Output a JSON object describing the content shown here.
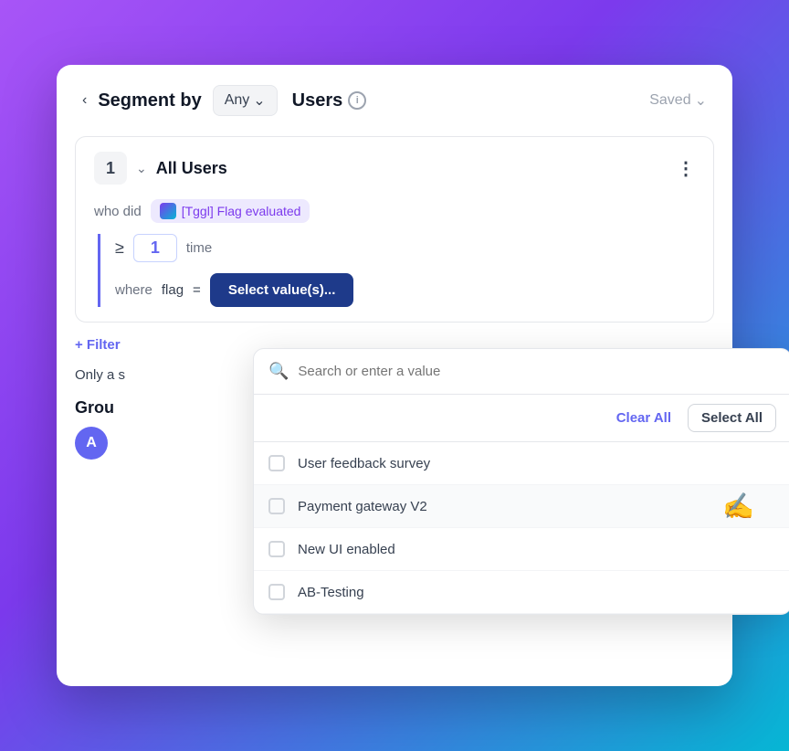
{
  "header": {
    "chevron": "‹",
    "segment_by": "Segment by",
    "any_label": "Any",
    "users_label": "Users",
    "saved_label": "Saved"
  },
  "segment_row": {
    "number": "1",
    "title": "All Users",
    "who_did": "who did",
    "flag_name": "[Tggl] Flag evaluated",
    "gte_symbol": "≥",
    "time_value": "1",
    "time_text": "time",
    "where_text": "where",
    "flag_text": "flag",
    "equals_text": "=",
    "select_btn": "Select value(s)..."
  },
  "dropdown": {
    "search_placeholder": "Search or enter a value",
    "clear_all": "Clear All",
    "select_all": "Select All",
    "options": [
      {
        "label": "User feedback survey",
        "checked": false
      },
      {
        "label": "Payment gateway V2",
        "checked": false
      },
      {
        "label": "New UI enabled",
        "checked": false
      },
      {
        "label": "AB-Testing",
        "checked": false
      }
    ]
  },
  "filter_btn": "+ Filter",
  "only_text": "Only a s",
  "group": {
    "label": "Grou",
    "avatar_letter": "A"
  }
}
